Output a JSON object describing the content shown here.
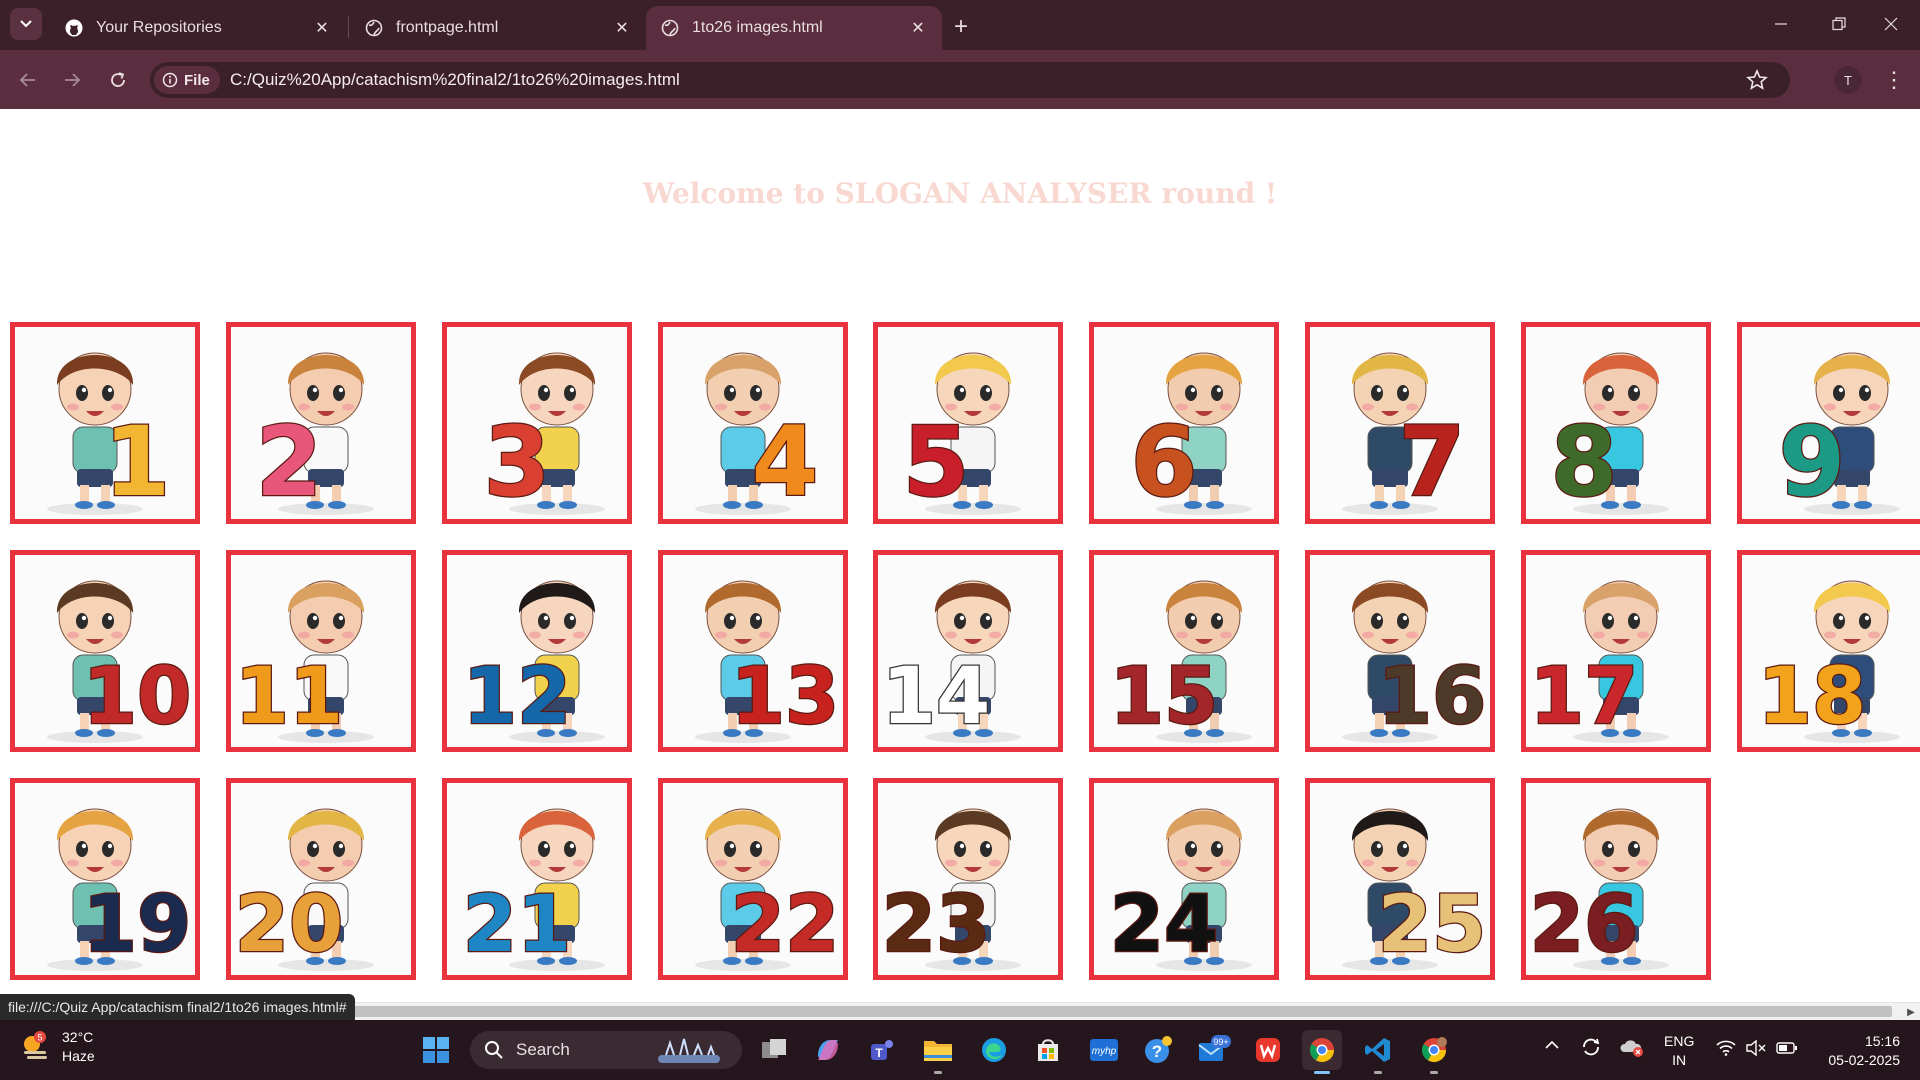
{
  "tabs": [
    {
      "label": "Your Repositories",
      "icon": "github-icon",
      "active": false
    },
    {
      "label": "frontpage.html",
      "icon": "globe-icon",
      "active": false
    },
    {
      "label": "1to26 images.html",
      "icon": "globe-icon",
      "active": true
    }
  ],
  "toolbar": {
    "chip_label": "File",
    "url": "C:/Quiz%20App/catachism%20final2/1to26%20images.html",
    "profile_initial": "T"
  },
  "page": {
    "heading": "Welcome to SLOGAN ANALYSER round !",
    "cards": [
      {
        "number": "1"
      },
      {
        "number": "2"
      },
      {
        "number": "3"
      },
      {
        "number": "4"
      },
      {
        "number": "5"
      },
      {
        "number": "6"
      },
      {
        "number": "7"
      },
      {
        "number": "8"
      },
      {
        "number": "9"
      },
      {
        "number": "10"
      },
      {
        "number": "11"
      },
      {
        "number": "12"
      },
      {
        "number": "13"
      },
      {
        "number": "14"
      },
      {
        "number": "15"
      },
      {
        "number": "16"
      },
      {
        "number": "17"
      },
      {
        "number": "18"
      },
      {
        "number": "19"
      },
      {
        "number": "20"
      },
      {
        "number": "21"
      },
      {
        "number": "22"
      },
      {
        "number": "23"
      },
      {
        "number": "24"
      },
      {
        "number": "25"
      },
      {
        "number": "26"
      }
    ],
    "status_url": "file:///C:/Quiz App/catachism final2/1to26 images.html#"
  },
  "taskbar": {
    "weather_temp": "32°C",
    "weather_desc": "Haze",
    "weather_badge": "5",
    "search_label": "Search",
    "mail_badge": "99+",
    "lang_line1": "ENG",
    "lang_line2": "IN",
    "time": "15:16",
    "date": "05-02-2025"
  },
  "colors": {
    "card_border": "#e8333f",
    "heading": "#f8d8d0",
    "chrome_dark": "#3b1f29",
    "chrome_toolbar": "#5b2e3f"
  }
}
